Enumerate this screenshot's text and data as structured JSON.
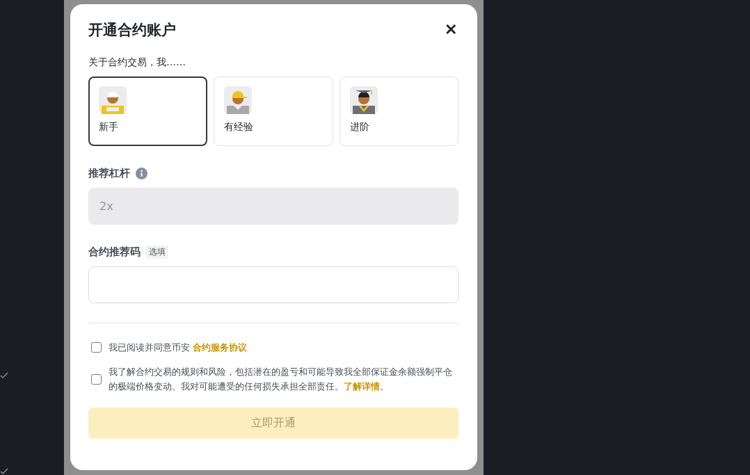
{
  "dialog": {
    "title": "开通合约账户",
    "close_icon": "✕"
  },
  "experience": {
    "question": "关于合约交易，我……",
    "options": [
      {
        "label": "新手",
        "kind": "helmet",
        "selected": true
      },
      {
        "label": "有经验",
        "kind": "cap",
        "selected": false
      },
      {
        "label": "进阶",
        "kind": "graduate",
        "selected": false
      }
    ]
  },
  "leverage": {
    "label": "推荐杠杆",
    "value": "2x",
    "disabled": true
  },
  "referral": {
    "label": "合约推荐码",
    "badge": "选填"
  },
  "agreements": [
    {
      "text": "我已阅读并同意币安 ",
      "link": "合约服务协议",
      "checked": false
    },
    {
      "text": "我了解合约交易的规则和风险，包括潜在的盈亏和可能导致我全部保证金余额强制平仓的极端价格变动。我对可能遭受的任何损失承担全部责任。",
      "link": "了解详情",
      "after": "。",
      "checked": false
    }
  ],
  "submit": {
    "label": "立即开通",
    "disabled": true
  }
}
